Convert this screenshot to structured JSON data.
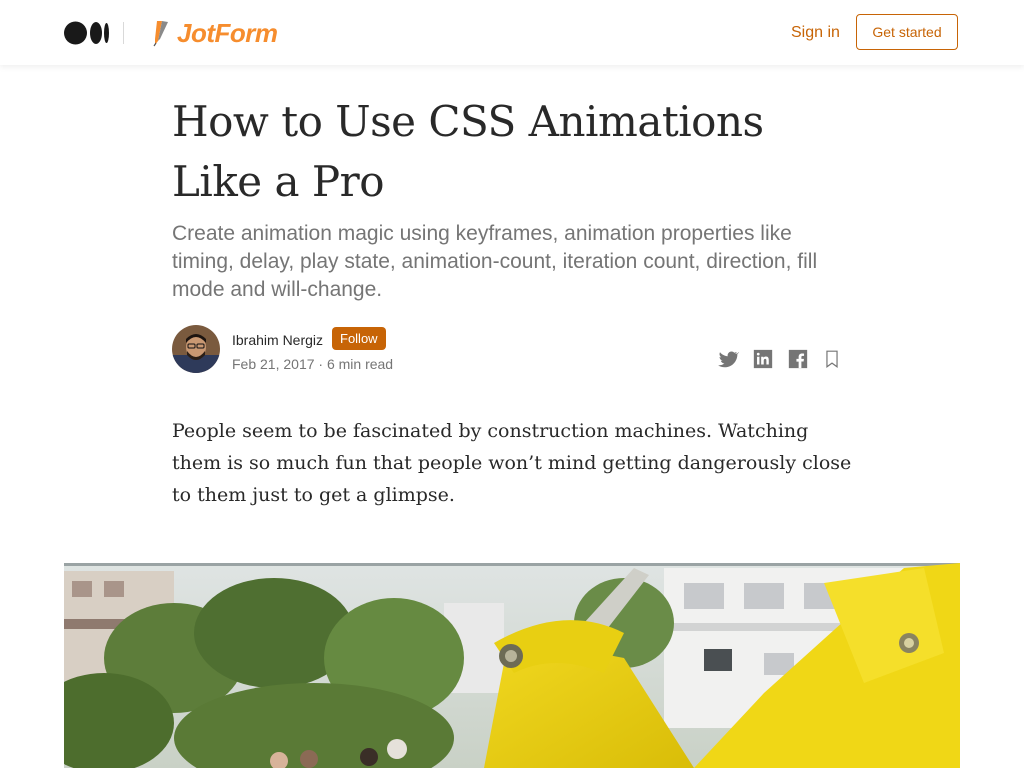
{
  "header": {
    "publication_name": "JotForm",
    "signin_label": "Sign in",
    "get_started_label": "Get started",
    "brand_color": "#c76406",
    "publication_color": "#f68d2e",
    "icons": [
      "medium-logo-icon",
      "jotform-pen-icon"
    ]
  },
  "article": {
    "title": "How to Use CSS Animations Like a Pro",
    "subtitle": "Create animation magic using keyframes, animation properties like timing, delay, play state, animation-count, iteration count, direction, fill mode and will-change.",
    "author": {
      "name": "Ibrahim Nergiz",
      "follow_label": "Follow",
      "meta": "Feb 21, 2017 · 6 min read"
    },
    "share_icons": [
      "twitter-icon",
      "linkedin-icon",
      "facebook-icon",
      "bookmark-icon"
    ],
    "intro_paragraph": "People seem to be fascinated by construction machines. Watching them is so much fun that people won’t mind getting dangerously close to them just to get a glimpse.",
    "hero_image": "excavator-photo"
  }
}
